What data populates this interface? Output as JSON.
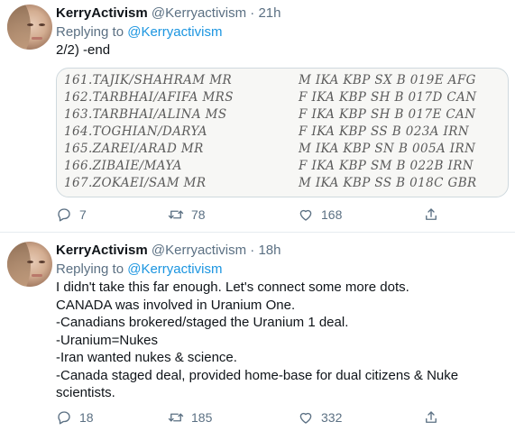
{
  "tweets": [
    {
      "name": "KerryActivism",
      "handle": "@Kerryactivism",
      "time": "21h",
      "replying_prefix": "Replying to",
      "replying_to": "@Kerryactivism",
      "text_lines": [
        "2/2)  -end"
      ],
      "media_rows": [
        {
          "name": "161.TAJIK/SHAHRAM MR",
          "info": "M IKA KBP SX B 019E AFG"
        },
        {
          "name": "162.TARBHAI/AFIFA MRS",
          "info": "F IKA KBP SH B 017D CAN"
        },
        {
          "name": "163.TARBHAI/ALINA MS",
          "info": "F IKA KBP SH B 017E CAN"
        },
        {
          "name": "164.TOGHIAN/DARYA",
          "info": "F IKA KBP SS B 023A IRN"
        },
        {
          "name": "165.ZAREI/ARAD MR",
          "info": "M IKA KBP SN B 005A IRN"
        },
        {
          "name": "166.ZIBAIE/MAYA",
          "info": "F IKA KBP SM B 022B IRN"
        },
        {
          "name": "167.ZOKAEI/SAM MR",
          "info": "M IKA KBP SS B 018C GBR"
        }
      ],
      "replies": "7",
      "retweets": "78",
      "likes": "168"
    },
    {
      "name": "KerryActivism",
      "handle": "@Kerryactivism",
      "time": "18h",
      "replying_prefix": "Replying to",
      "replying_to": "@Kerryactivism",
      "text_lines": [
        "I didn't take this far enough. Let's connect some more dots.",
        "CANADA was involved in Uranium One.",
        "-Canadians brokered/staged the Uranium 1 deal.",
        "-Uranium=Nukes",
        "-Iran wanted nukes & science.",
        "-Canada staged deal, provided home-base for dual citizens & Nuke",
        "scientists."
      ],
      "replies": "18",
      "retweets": "185",
      "likes": "332"
    }
  ],
  "separator": "·",
  "icons": {
    "reply": "reply-icon",
    "retweet": "retweet-icon",
    "like": "heart-icon",
    "share": "share-icon"
  },
  "colors": {
    "secondary_text": "#5b7083",
    "link": "#1b95e0",
    "text": "#0f1419"
  }
}
